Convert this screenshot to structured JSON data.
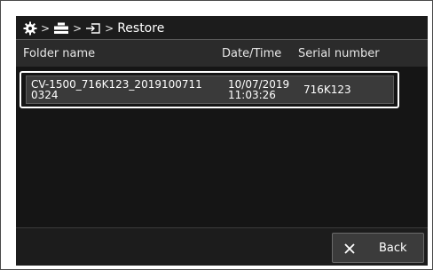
{
  "breadcrumb": {
    "icons": [
      "gear-icon",
      "device-icon",
      "restore-icon"
    ],
    "separator": ">",
    "current": "Restore"
  },
  "table": {
    "headers": {
      "folder_name": "Folder name",
      "date_time": "Date/Time",
      "serial_number": "Serial number"
    },
    "rows": [
      {
        "folder_name_line1": "CV-1500_716K123_2019100711",
        "folder_name_line2": "0324",
        "date": "10/07/2019",
        "time": "11:03:26",
        "serial": "716K123",
        "selected": true
      }
    ]
  },
  "footer": {
    "back_label": "Back",
    "back_icon": "close-icon"
  }
}
